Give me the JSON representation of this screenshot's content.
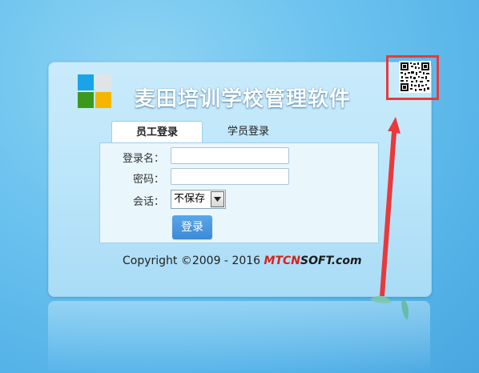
{
  "app": {
    "title": "麦田培训学校管理软件"
  },
  "tabs": [
    {
      "label": "员工登录",
      "active": true
    },
    {
      "label": "学员登录",
      "active": false
    }
  ],
  "form": {
    "username_label": "登录名：",
    "password_label": "密码：",
    "session_label": "会话：",
    "username_value": "",
    "password_value": "",
    "session_selected": "不保存",
    "login_button": "登录"
  },
  "footer": {
    "copyright": "Copyright ©2009 - 2016 ",
    "brand_red": "MTCN",
    "brand_dark": "SOFT.com"
  },
  "icons": {
    "logo": "app-logo-icon",
    "qr": "qr-code-icon",
    "dropdown": "chevron-down-icon"
  },
  "colors": {
    "background": "#56b3e8",
    "panel": "#bde6fa",
    "accent": "#3d8ad6",
    "highlight": "#e8393d",
    "brand_red": "#d8201a"
  }
}
